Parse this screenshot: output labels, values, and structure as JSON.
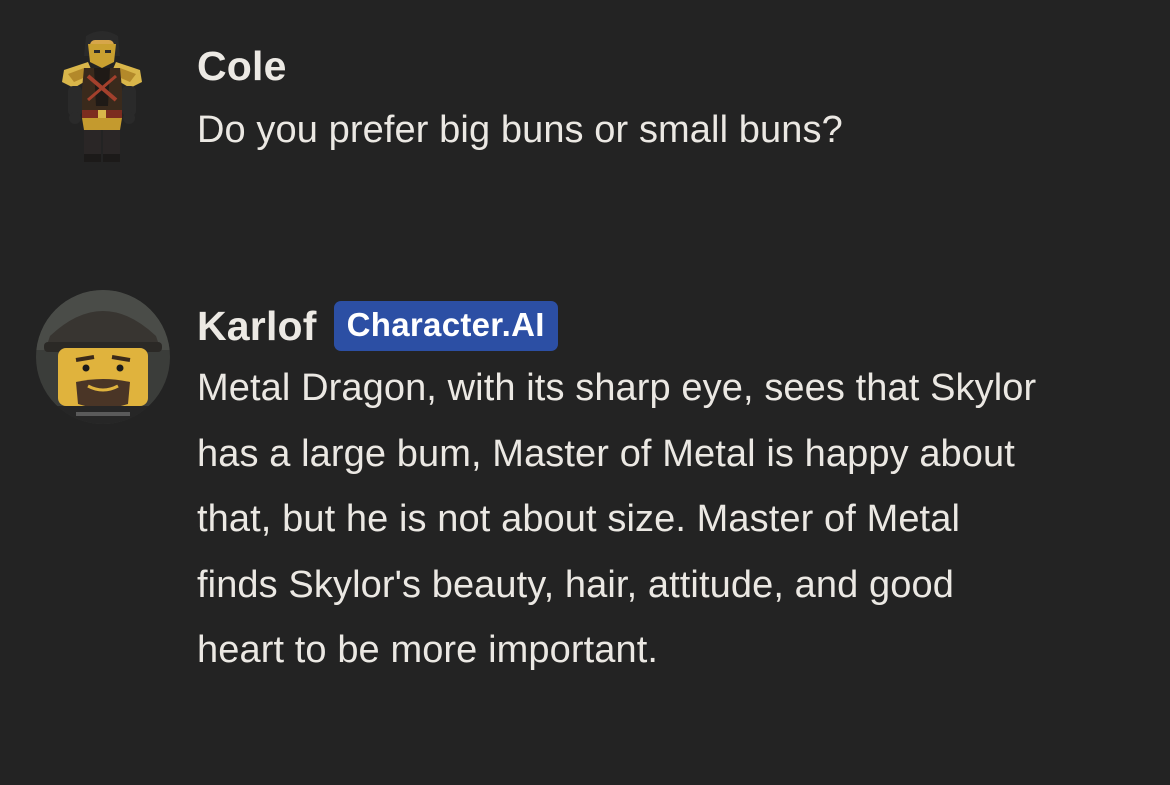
{
  "messages": [
    {
      "author": "Cole",
      "avatar_icon": "lego-ninja-gold-armor-avatar",
      "text": "Do you prefer big buns or small buns?"
    },
    {
      "author": "Karlof",
      "badge": "Character.AI",
      "avatar_icon": "lego-helmet-bearded-face-avatar",
      "text": "Metal Dragon, with its sharp eye, sees that Skylor has a large bum, Master of Metal is happy about that, but he is not about size. Master of Metal finds Skylor's beauty, hair, attitude, and good heart to be more important."
    }
  ],
  "colors": {
    "background": "#232323",
    "text": "#ebe8e3",
    "badge_bg": "#2c4fa4",
    "badge_text": "#ffffff"
  }
}
